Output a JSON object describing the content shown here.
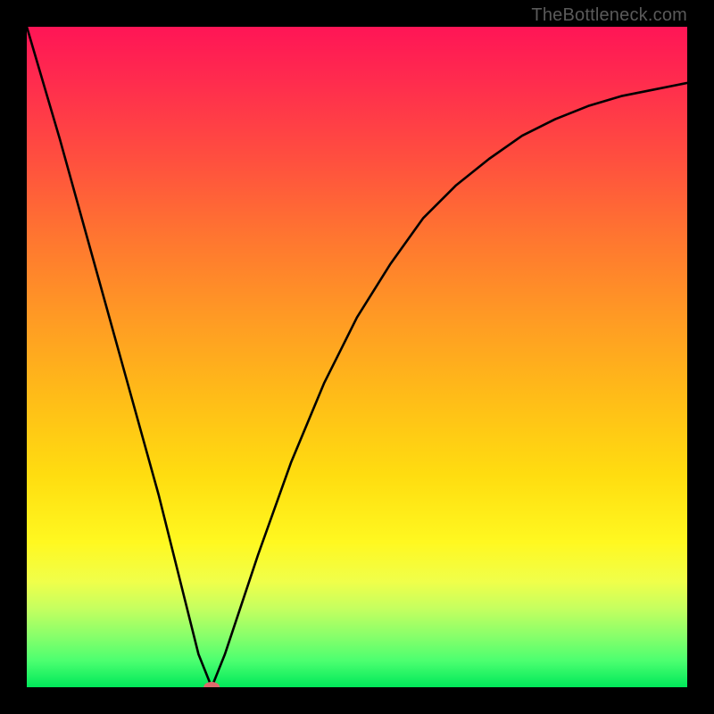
{
  "attribution": "TheBottleneck.com",
  "chart_data": {
    "type": "line",
    "title": "",
    "xlabel": "",
    "ylabel": "",
    "xlim": [
      0,
      100
    ],
    "ylim": [
      0,
      100
    ],
    "grid": false,
    "series": [
      {
        "name": "bottleneck-curve",
        "x": [
          0,
          5,
          10,
          15,
          20,
          24,
          26,
          28,
          30,
          35,
          40,
          45,
          50,
          55,
          60,
          65,
          70,
          75,
          80,
          85,
          90,
          95,
          100
        ],
        "values": [
          100,
          83,
          65,
          47,
          29,
          13,
          5,
          0,
          5,
          20,
          34,
          46,
          56,
          64,
          71,
          76,
          80,
          83.5,
          86,
          88,
          89.5,
          90.5,
          91.5
        ]
      }
    ],
    "marker": {
      "name": "minimum-point",
      "x": 28,
      "y": 0,
      "color": "#de6a6c"
    }
  }
}
